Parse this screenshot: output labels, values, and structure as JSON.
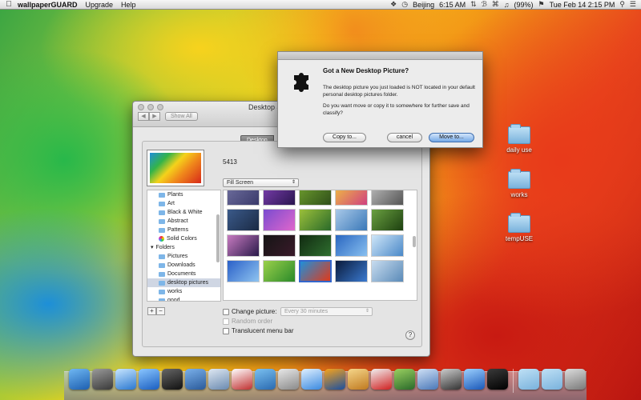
{
  "menubar": {
    "apple": "",
    "app_name": "wallpaperGUARD",
    "menus": [
      "Upgrade",
      "Help"
    ],
    "location": "Beijing",
    "time": "6:15 AM",
    "battery": "(99%)",
    "datetime": "Tue Feb 14  2:15 PM"
  },
  "prefs_window": {
    "title": "Desktop &",
    "show_all": "Show All",
    "tab_desktop": "Desktop",
    "picture_name": "5413",
    "fill_mode": "Fill Screen",
    "source_list": [
      {
        "label": "Plants",
        "type": "folder"
      },
      {
        "label": "Art",
        "type": "folder"
      },
      {
        "label": "Black & White",
        "type": "folder"
      },
      {
        "label": "Abstract",
        "type": "folder"
      },
      {
        "label": "Patterns",
        "type": "folder"
      },
      {
        "label": "Solid Colors",
        "type": "solid"
      },
      {
        "label": "Folders",
        "type": "header"
      },
      {
        "label": "Pictures",
        "type": "folder"
      },
      {
        "label": "Downloads",
        "type": "folder"
      },
      {
        "label": "Documents",
        "type": "folder"
      },
      {
        "label": "desktop pictures",
        "type": "folder",
        "selected": true
      },
      {
        "label": "works",
        "type": "folder"
      },
      {
        "label": "good",
        "type": "folder"
      }
    ],
    "add_label": "+",
    "remove_label": "−",
    "change_picture_label": "Change picture:",
    "interval": "Every 30 minutes",
    "random_order_label": "Random order",
    "translucent_menu_label": "Translucent menu bar",
    "help_label": "?"
  },
  "thumbnails": [
    {
      "colors": [
        "#6f6f9f",
        "#3a3a6a"
      ]
    },
    {
      "colors": [
        "#7d3fb0",
        "#2a1650"
      ]
    },
    {
      "colors": [
        "#6e9e2e",
        "#2f4f1a"
      ]
    },
    {
      "colors": [
        "#f0c040",
        "#d04080"
      ]
    },
    {
      "colors": [
        "#bbbbbb",
        "#555555"
      ]
    },
    {
      "colors": [
        "#3b5a8a",
        "#1a2a44"
      ]
    },
    {
      "colors": [
        "#7a4cd0",
        "#e066cc"
      ]
    },
    {
      "colors": [
        "#9bbf3a",
        "#2a6a2a"
      ]
    },
    {
      "colors": [
        "#a8c8e8",
        "#3a78b8"
      ]
    },
    {
      "colors": [
        "#6aa040",
        "#1d4010"
      ]
    },
    {
      "colors": [
        "#c77ac0",
        "#2a1a4a"
      ]
    },
    {
      "colors": [
        "#151515",
        "#3a1a2a"
      ]
    },
    {
      "colors": [
        "#112a11",
        "#2f6f2f"
      ]
    },
    {
      "colors": [
        "#2a66c0",
        "#88c0f0"
      ]
    },
    {
      "colors": [
        "#cfe6f8",
        "#4a88c8"
      ]
    },
    {
      "colors": [
        "#2a60c8",
        "#8fc4f0"
      ]
    },
    {
      "colors": [
        "#9ad04a",
        "#2a8a2a"
      ]
    },
    {
      "colors": [
        "#1f8fd9",
        "#e03a1a"
      ],
      "selected": true
    },
    {
      "colors": [
        "#0a1a3a",
        "#3a7ad0"
      ]
    },
    {
      "colors": [
        "#c8dcef",
        "#5a8ab8"
      ]
    }
  ],
  "dialog": {
    "title": "Got a New Desktop Picture?",
    "message1": "The desktop picture you just loaded is NOT located in your default personal desktop pictures folder.",
    "message2": "Do you want move or copy it to somewhere for further save and classify?",
    "copy_label": "Copy to...",
    "cancel_label": "cancel",
    "move_label": "Move to..."
  },
  "desktop_icons": [
    "daily use",
    "works",
    "tempUSE"
  ],
  "dock": {
    "icons": [
      {
        "name": "finder",
        "colors": [
          "#6fb7f2",
          "#1d5fb0"
        ]
      },
      {
        "name": "launchpad",
        "colors": [
          "#9a9a9a",
          "#3a3a3a"
        ]
      },
      {
        "name": "itunes",
        "colors": [
          "#c8e6ff",
          "#2a78d0"
        ]
      },
      {
        "name": "app-store",
        "colors": [
          "#8ac6ff",
          "#1a5ec0"
        ]
      },
      {
        "name": "dashboard",
        "colors": [
          "#666666",
          "#111111"
        ]
      },
      {
        "name": "people",
        "colors": [
          "#7ab0ea",
          "#2a5a9a"
        ]
      },
      {
        "name": "preview",
        "colors": [
          "#dfe8f2",
          "#6a8ab0"
        ]
      },
      {
        "name": "activity",
        "colors": [
          "#ffffff",
          "#c03030"
        ]
      },
      {
        "name": "globe",
        "colors": [
          "#7ac0f0",
          "#2a6ab0"
        ]
      },
      {
        "name": "utility",
        "colors": [
          "#e8e8e8",
          "#8a8a8a"
        ]
      },
      {
        "name": "safari",
        "colors": [
          "#e0f0ff",
          "#3a8ae0"
        ]
      },
      {
        "name": "firefox",
        "colors": [
          "#f7a31c",
          "#1a4fa0"
        ]
      },
      {
        "name": "pencil",
        "colors": [
          "#f5d68a",
          "#c07a20"
        ]
      },
      {
        "name": "pdf",
        "colors": [
          "#f0f0f0",
          "#d02020"
        ]
      },
      {
        "name": "xcode",
        "colors": [
          "#9ad060",
          "#2a6a2a"
        ]
      },
      {
        "name": "script",
        "colors": [
          "#cfe0f5",
          "#4a78b8"
        ]
      },
      {
        "name": "zip",
        "colors": [
          "#cccccc",
          "#333333"
        ]
      },
      {
        "name": "magic",
        "colors": [
          "#9cd0ff",
          "#1a58b8"
        ]
      },
      {
        "name": "puzzle",
        "colors": [
          "#3a3a3a",
          "#000000"
        ]
      },
      {
        "name": "downloads",
        "colors": [
          "#bfe0f5",
          "#79b2dc"
        ]
      },
      {
        "name": "documents",
        "colors": [
          "#bfe0f5",
          "#79b2dc"
        ]
      },
      {
        "name": "trash",
        "colors": [
          "#dcdcdc",
          "#7a7a7a"
        ]
      }
    ]
  }
}
